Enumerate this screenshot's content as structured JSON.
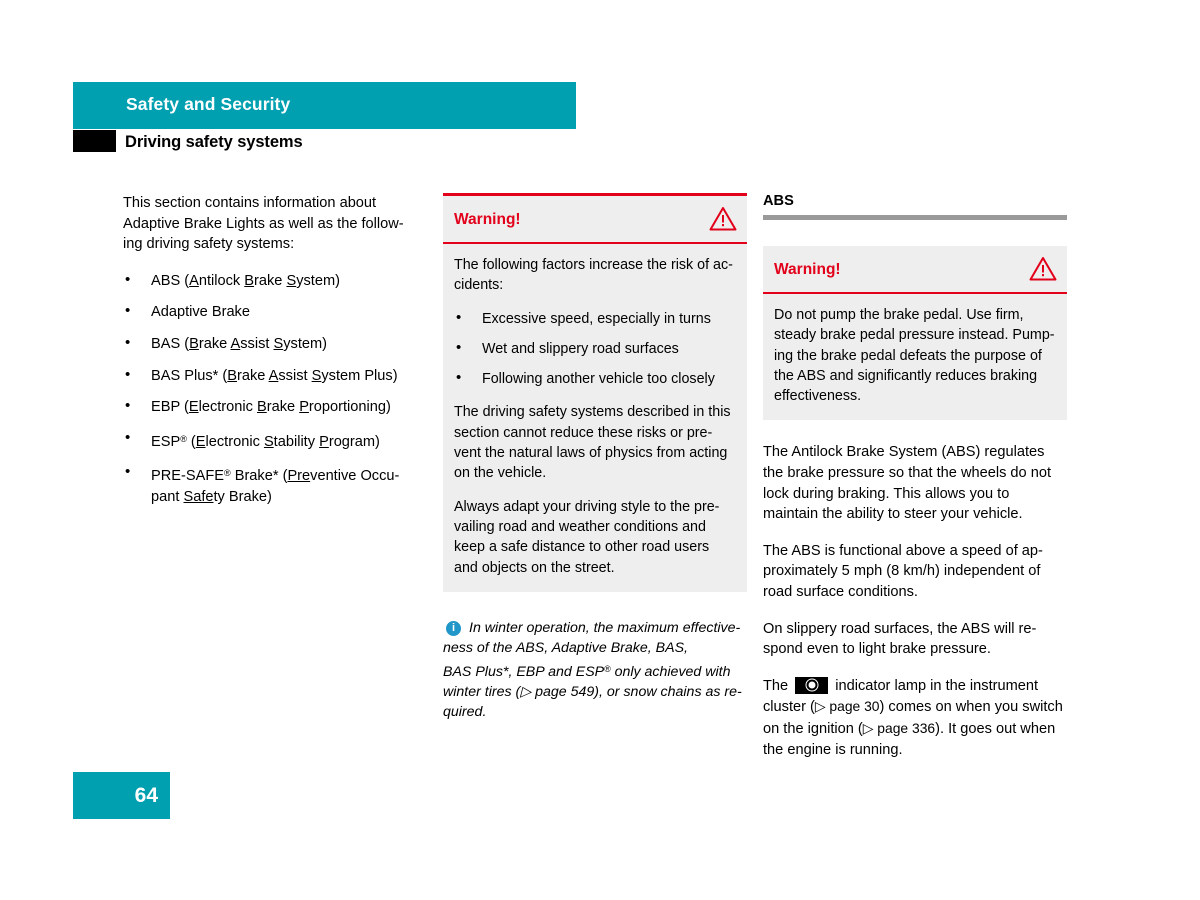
{
  "header": {
    "band_title": "Safety and Security",
    "subtitle": "Driving safety systems"
  },
  "left_column": {
    "intro": "This section contains information about Adaptive Brake Lights as well as the follow-ing driving safety systems:",
    "systems": [
      {
        "text": "ABS (Antilock Brake System)"
      },
      {
        "text": "Adaptive Brake"
      },
      {
        "text": "BAS (Brake Assist System)"
      },
      {
        "text": "BAS Plus* (Brake Assist System Plus)"
      },
      {
        "text": "EBP (Electronic Brake Proportioning)"
      },
      {
        "text": "ESP® (Electronic Stability Program)"
      },
      {
        "text": "PRE-SAFE® Brake* (Preventive Occupant Safety Brake)"
      }
    ]
  },
  "middle_column": {
    "warning": {
      "title": "Warning!",
      "icon": "warning-triangle-icon",
      "intro": "The following factors increase the risk of ac-cidents:",
      "factors": [
        "Excessive speed, especially in turns",
        "Wet and slippery road surfaces",
        "Following another vehicle too closely"
      ],
      "paragraph_1": "The driving safety systems described in this section cannot reduce these risks or pre-vent the natural laws of physics from acting on the vehicle.",
      "paragraph_2": "Always adapt your driving style to the pre-vailing road and weather conditions and keep a safe distance to other road users and objects on the street."
    },
    "note": {
      "icon": "info-icon",
      "line_1": "In winter operation, the maximum effective-",
      "line_2": "ness of the ABS, Adaptive Brake, BAS,",
      "line_3_a": "BAS Plus*, EBP and ESP",
      "line_3_b": " only achieved with",
      "line_4_a": "winter tires (",
      "line_4_ref": "▷ page 549",
      "line_4_b": "), or snow chains as re-",
      "line_5": "quired."
    }
  },
  "right_column": {
    "heading": "ABS",
    "warning": {
      "title": "Warning!",
      "icon": "warning-triangle-icon",
      "body": "Do not pump the brake pedal. Use firm, steady brake pedal pressure instead. Pump-ing the brake pedal defeats the purpose of the ABS and significantly reduces braking effectiveness."
    },
    "paragraph_1": "The Antilock Brake System (ABS) regulates the brake pressure so that the wheels do not lock during braking. This allows you to maintain the ability to steer your vehicle.",
    "paragraph_2": "The ABS is functional above a speed of ap-proximately 5 mph (8 km/h) independent of road surface conditions.",
    "paragraph_3": "On slippery road surfaces, the ABS will re-spond even to light brake pressure.",
    "lamp_paragraph": {
      "before_icon": "The ",
      "icon": "abs-indicator-lamp-icon",
      "after_icon_a": " indicator lamp in the instrument cluster (",
      "ref_1": "▷ page 30",
      "after_icon_b": ") comes on when you switch on the ignition (",
      "ref_2": "▷ page 336",
      "after_icon_c": "). It goes out when the engine is running."
    }
  },
  "footer": {
    "page_number": "64"
  },
  "colors": {
    "teal": "#00a0b0",
    "warning_red": "#e2001a",
    "box_gray": "#eeeeee",
    "rule_gray": "#9a9a9a",
    "info_blue": "#2196c8"
  }
}
